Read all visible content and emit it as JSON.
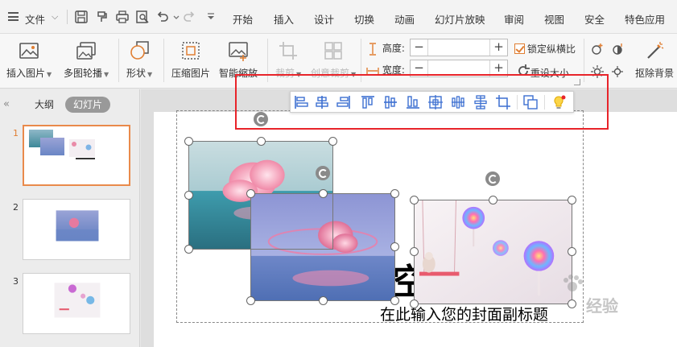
{
  "menu": {
    "file_label": "文件",
    "tabs": [
      "开始",
      "插入",
      "设计",
      "切换",
      "动画",
      "幻灯片放映",
      "审阅",
      "视图",
      "安全",
      "特色应用"
    ]
  },
  "ribbon": {
    "insert_picture": "插入图片",
    "multi_carousel": "多图轮播",
    "shape": "形状",
    "compress_picture": "压缩图片",
    "smart_zoom": "智能缩放",
    "crop": "裁剪",
    "create_crop": "创意裁剪",
    "height_label": "高度:",
    "width_label": "宽度:",
    "lock_ratio": "锁定纵横比",
    "reset_size": "重设大小",
    "remove_background": "抠除背景"
  },
  "left_panel": {
    "tab_outline": "大纲",
    "tab_slides": "幻灯片",
    "slides": [
      "1",
      "2",
      "3"
    ]
  },
  "slide": {
    "subtitle_placeholder": "在此输入您的封面副标题",
    "title_fragment": "空"
  },
  "watermark": {
    "text": "经验"
  },
  "colors": {
    "accent": "#e07e32",
    "highlight": "#e8242a",
    "align_icon": "#3c6fd1"
  }
}
